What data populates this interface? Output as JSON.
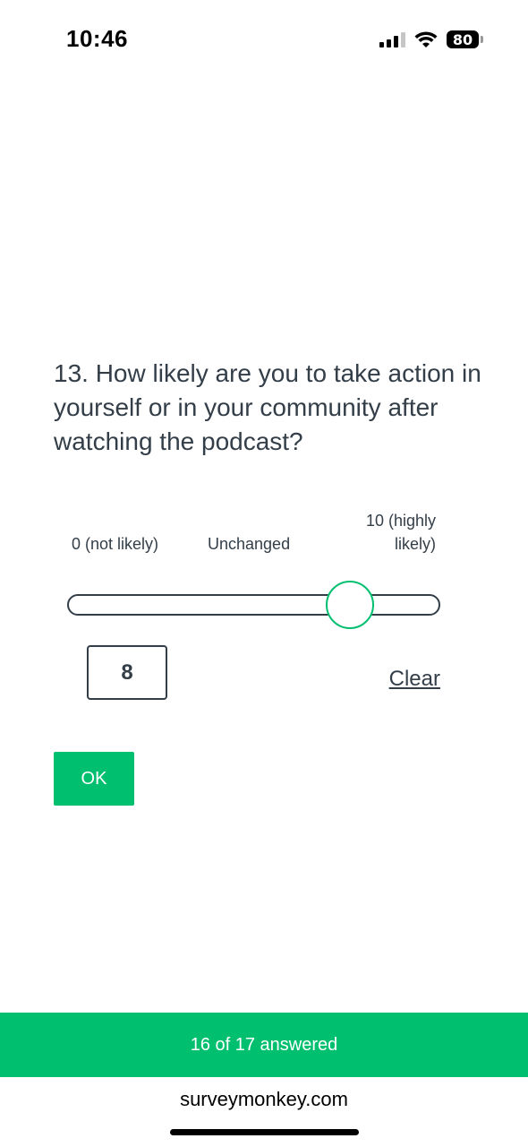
{
  "status_bar": {
    "time": "10:46",
    "battery": "80",
    "icons": [
      "cellular-signal-icon",
      "wifi-icon",
      "battery-icon"
    ]
  },
  "question": {
    "text": "13. How likely are you to take action in yourself or in your community after watching the podcast?"
  },
  "slider": {
    "min_label": "0 (not likely)",
    "mid_label": "Unchanged",
    "max_label": "10 (highly likely)",
    "min": 0,
    "max": 10,
    "value": 8
  },
  "value_input": {
    "value": "8"
  },
  "clear_label": "Clear",
  "ok_label": "OK",
  "progress": {
    "text": "16 of 17 answered",
    "answered": 16,
    "total": 17
  },
  "footer": {
    "domain": "surveymonkey.com"
  },
  "colors": {
    "accent": "#00bf6f",
    "text": "#333e48"
  }
}
